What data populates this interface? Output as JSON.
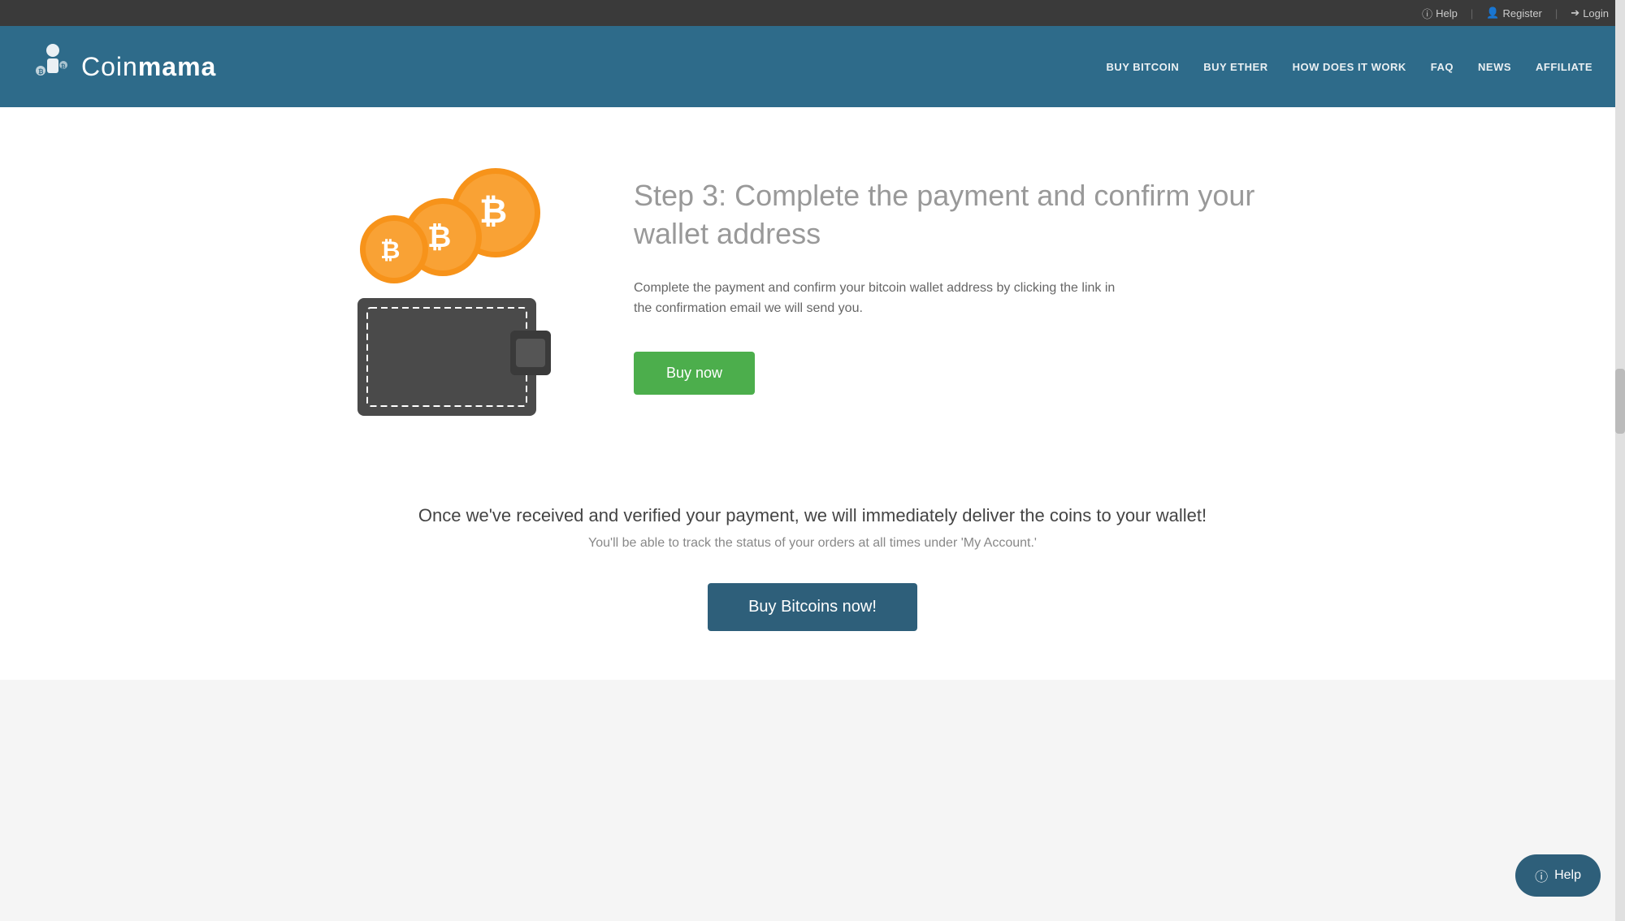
{
  "topbar": {
    "help_label": "Help",
    "register_label": "Register",
    "login_label": "Login"
  },
  "header": {
    "logo_text_regular": "Coin",
    "logo_text_bold": "mama",
    "nav_items": [
      {
        "label": "BUY BITCOIN",
        "id": "nav-buy-bitcoin"
      },
      {
        "label": "BUY ETHER",
        "id": "nav-buy-ether"
      },
      {
        "label": "HOW DOES IT WORK",
        "id": "nav-how-it-works"
      },
      {
        "label": "FAQ",
        "id": "nav-faq"
      },
      {
        "label": "NEWS",
        "id": "nav-news"
      },
      {
        "label": "AFFILIATE",
        "id": "nav-affiliate"
      }
    ]
  },
  "step": {
    "title": "Step 3: Complete the payment and confirm your wallet address",
    "description": "Complete the payment and confirm your bitcoin wallet address by clicking the link in the confirmation email we will send you.",
    "buy_now_label": "Buy now"
  },
  "delivery": {
    "main_text": "Once we've received and verified your payment, we will immediately deliver the coins to your wallet!",
    "sub_text": "You'll be able to track the status of your orders at all times under 'My Account.'",
    "cta_label": "Buy Bitcoins now!"
  },
  "help_button": {
    "label": "Help"
  },
  "colors": {
    "header_bg": "#2e6b8a",
    "green_btn": "#4cae4c",
    "dark_btn": "#2e5f7a",
    "bitcoin_orange": "#f7931a"
  }
}
